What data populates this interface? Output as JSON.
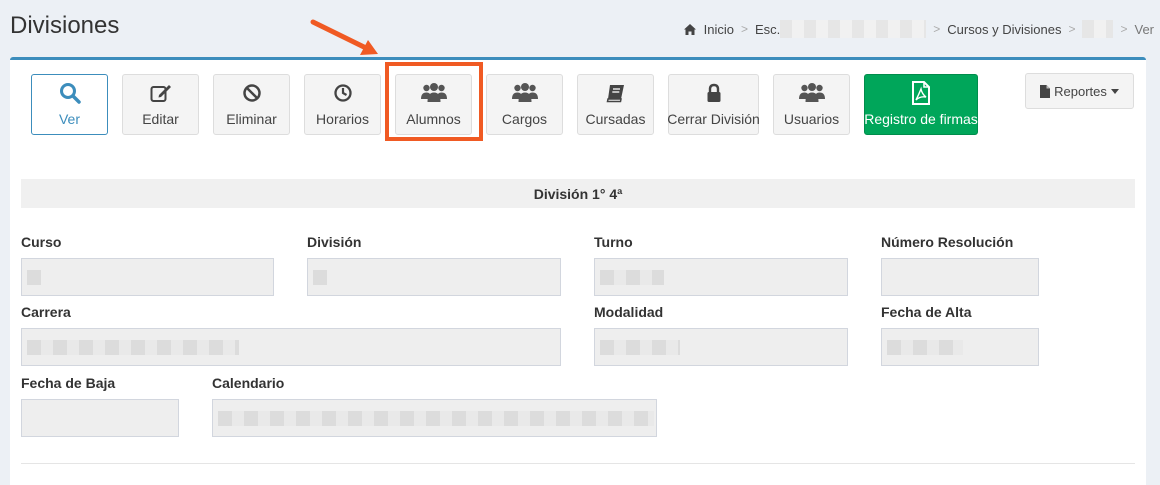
{
  "page": {
    "title": "Divisiones"
  },
  "breadcrumb": {
    "items": [
      "Inicio",
      "Esc.",
      "Cursos y Divisiones",
      "Ver"
    ]
  },
  "toolbar": {
    "buttons": [
      {
        "label": "Ver",
        "icon": "search-icon"
      },
      {
        "label": "Editar",
        "icon": "edit-icon"
      },
      {
        "label": "Eliminar",
        "icon": "ban-icon"
      },
      {
        "label": "Horarios",
        "icon": "clock-icon"
      },
      {
        "label": "Alumnos",
        "icon": "users-icon"
      },
      {
        "label": "Cargos",
        "icon": "users-icon"
      },
      {
        "label": "Cursadas",
        "icon": "book-icon"
      },
      {
        "label": "Cerrar División",
        "icon": "lock-icon"
      },
      {
        "label": "Usuarios",
        "icon": "users-icon"
      },
      {
        "label": "Registro de firmas",
        "icon": "file-pdf-icon"
      }
    ],
    "reportes_label": "Reportes"
  },
  "section": {
    "title": "División 1° 4ª"
  },
  "fields": {
    "curso": "Curso",
    "division": "División",
    "turno": "Turno",
    "numero_resolucion": "Número Resolución",
    "carrera": "Carrera",
    "modalidad": "Modalidad",
    "fecha_alta": "Fecha de Alta",
    "fecha_baja": "Fecha de Baja",
    "calendario": "Calendario"
  },
  "colors": {
    "accent": "#3c8dbc",
    "success": "#00a65a",
    "highlight": "#f05a23",
    "background": "#ecf0f5"
  }
}
